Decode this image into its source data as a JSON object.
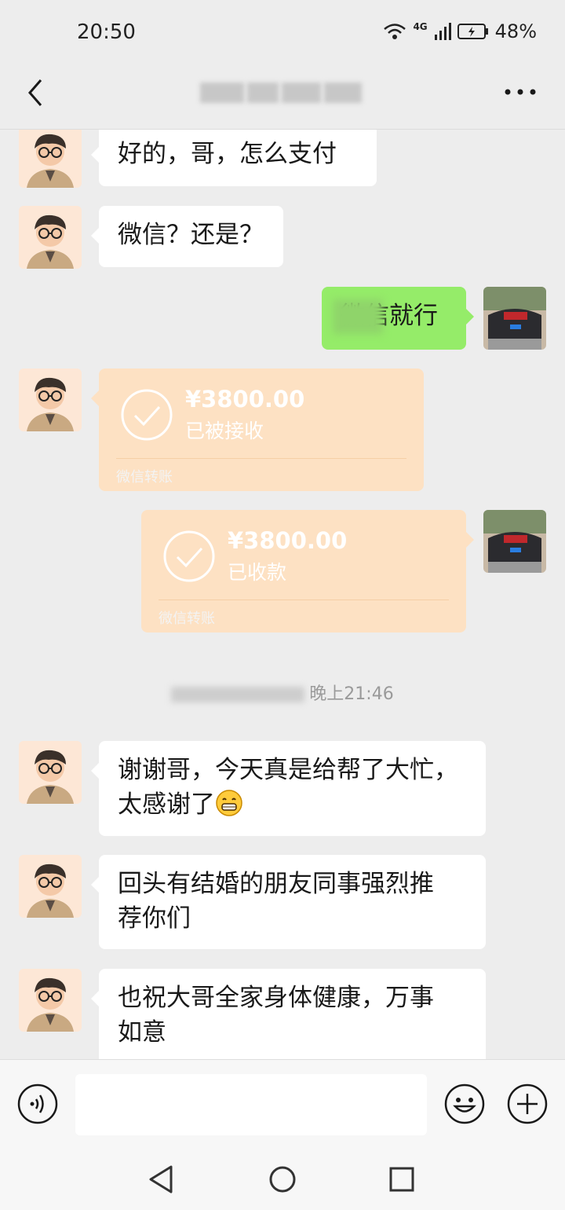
{
  "status_bar": {
    "time": "20:50",
    "network": "4G",
    "battery": "48%"
  },
  "header": {
    "title_redacted": true
  },
  "messages": [
    {
      "side": "left",
      "text": "好的，哥，怎么支付"
    },
    {
      "side": "left",
      "text": "微信？还是？"
    },
    {
      "side": "right",
      "text": "微信就行",
      "partially_redacted": true
    },
    {
      "side": "left",
      "type": "transfer",
      "amount": "¥3800.00",
      "status": "已被接收",
      "label": "微信转账"
    },
    {
      "side": "right",
      "type": "transfer",
      "amount": "¥3800.00",
      "status": "已收款",
      "label": "微信转账"
    },
    {
      "side": "left",
      "text_line1": "谢谢哥，今天真是给帮了大忙，",
      "text_line2": "太感谢了"
    },
    {
      "side": "left",
      "text_line1": "回头有结婚的朋友同事强烈推",
      "text_line2": "荐你们"
    },
    {
      "side": "left",
      "text_line1": "也祝大哥全家身体健康，万事",
      "text_line2": "如意"
    }
  ],
  "timestamp": {
    "visible_text": "晚上21:46",
    "partially_redacted": true
  },
  "colors": {
    "background": "#ededed",
    "sent_bubble": "#95ec69",
    "received_bubble": "#ffffff",
    "transfer": "#fde1c3"
  },
  "icons": [
    "back-icon",
    "more-icon",
    "voice-icon",
    "emoji-icon",
    "plus-icon",
    "nav-back-icon",
    "nav-home-icon",
    "nav-recent-icon"
  ]
}
